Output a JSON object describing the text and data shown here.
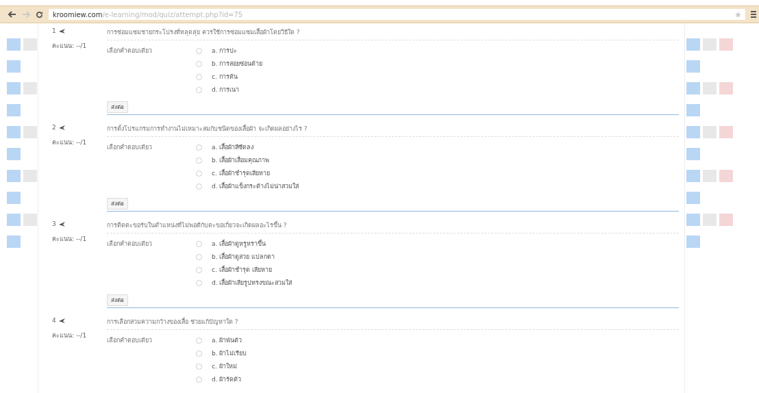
{
  "browser": {
    "url_host": "kroomiew.com",
    "url_path": "/e-learning/mod/quiz/attempt.php?id=75"
  },
  "questions": [
    {
      "number": "1",
      "grade": "คะแนน: --/1",
      "text": "การซ่อมแซมชายกระโปรงที่หลุดลุ่ย ควรใช้การซ่อมแซมเสื้อผ้าโดยวิธีใด ?",
      "prompt": "เลือกคำตอบเดียว",
      "options": [
        {
          "label": "a. การปะ",
          "selected": false
        },
        {
          "label": "b. การสอยซ่อนด้าย",
          "selected": false
        },
        {
          "label": "c. การด้น",
          "selected": false
        },
        {
          "label": "d. การเนา",
          "selected": false
        }
      ],
      "submit": "ส่งต่อ"
    },
    {
      "number": "2",
      "grade": "คะแนน: --/1",
      "text": "การตั้งโปรแกรมการทำงานไม่เหมาะสมกับชนิดของเสื้อผ้า จะเกิดผลอย่างไร ?",
      "prompt": "เลือกคำตอบเดียว",
      "options": [
        {
          "label": "a. เสื้อผ้าสีซีดลง",
          "selected": false
        },
        {
          "label": "b. เสื้อผ้าเสื่อมคุณภาพ",
          "selected": false
        },
        {
          "label": "c. เสื้อผ้าชำรุดเสียหาย",
          "selected": false
        },
        {
          "label": "d. เสื้อผ้าแข็งกระด้างไม่น่าสวมใส่",
          "selected": false
        }
      ],
      "submit": "ส่งต่อ"
    },
    {
      "number": "3",
      "grade": "คะแนน: --/1",
      "text": "การติดตะขอรับในตำแหน่งที่ไม่พอดีกับตะขอเกี่ยวจะเกิดผลอะไรขึ้น ?",
      "prompt": "เลือกคำตอบเดียว",
      "options": [
        {
          "label": "a. เสื้อผ้าดูหรูหราขึ้น",
          "selected": false
        },
        {
          "label": "b. เสื้อผ้าดูสวย แปลกตา",
          "selected": false
        },
        {
          "label": "c. เสื้อผ้าชำรุด เสียหาย",
          "selected": false
        },
        {
          "label": "d. เสื้อผ้าเสียรูปทรงขณะสวมใส่",
          "selected": false
        }
      ],
      "submit": "ส่งต่อ"
    },
    {
      "number": "4",
      "grade": "คะแนน: --/1",
      "text": "การเลือกสวมความกว้างของเสื้อ ช่วยแก้ปัญหาใด ?",
      "prompt": "เลือกคำตอบเดียว",
      "options": [
        {
          "label": "a. ผ้าพันตัว",
          "selected": false
        },
        {
          "label": "b. ผ้าไม่เรียบ",
          "selected": false
        },
        {
          "label": "c. ผ้าใหม่",
          "selected": false
        },
        {
          "label": "d. ผ้ารัดตัว",
          "selected": false
        }
      ]
    }
  ]
}
